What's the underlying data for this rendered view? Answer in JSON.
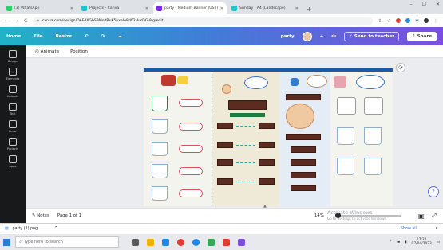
{
  "browser": {
    "tabs": [
      {
        "label": "(3) WhatsApp",
        "active": false,
        "favicon_color": "#25d366"
      },
      {
        "label": "Projects - Canva",
        "active": false,
        "favicon_color": "#20c4cb"
      },
      {
        "label": "party - Medium Banner (US) (La...",
        "active": true,
        "favicon_color": "#7d2ae8"
      },
      {
        "label": "Sunday - A4 (Landscape)",
        "active": false,
        "favicon_color": "#20c4cb"
      }
    ],
    "new_tab_symbol": "+",
    "url": "canva.com/design/DAFdXGbS9Ms/tBuK5uxeIe8d02HvsDG-9ig/edit",
    "window_controls": [
      "–",
      "☐",
      "✕"
    ]
  },
  "canva_bar": {
    "left_items": [
      "Home",
      "File",
      "Resize"
    ],
    "undo_symbol": "↶",
    "redo_symbol": "↷",
    "sync_symbol": "☁",
    "doc_title": "party",
    "plus_symbol": "+",
    "chart_symbol": "ılı",
    "send_to_teacher": "Send to teacher",
    "share": "Share"
  },
  "rail": [
    {
      "label": "Design",
      "icon": "layout-icon"
    },
    {
      "label": "Elements",
      "icon": "shapes-icon"
    },
    {
      "label": "Uploads",
      "icon": "upload-icon"
    },
    {
      "label": "Text",
      "icon": "text-icon"
    },
    {
      "label": "Draw",
      "icon": "pen-icon"
    },
    {
      "label": "Projects",
      "icon": "folder-icon"
    },
    {
      "label": "Apps",
      "icon": "grid-icon"
    }
  ],
  "editor_toolbar": {
    "animate": "Animate",
    "position": "Position"
  },
  "footer": {
    "notes": "Notes",
    "page_info": "Page 1 of 1",
    "zoom": "14%",
    "zoom_fraction": 0.0
  },
  "watermark": {
    "title": "Activate Windows",
    "subtitle": "Go to Settings to activate Windows."
  },
  "downloads": {
    "file": "party (1).png",
    "caret": "^",
    "show_all": "Show all",
    "close": "✕"
  },
  "taskbar": {
    "search_placeholder": "Type here to search",
    "time": "17:21",
    "date": "07/04/2023",
    "app_colors": [
      "#5a5a5a",
      "#f0b400",
      "#1e88e5",
      "#e53935",
      "#1e88e5",
      "#34a853",
      "#e53935",
      "#7b4ee0"
    ]
  }
}
